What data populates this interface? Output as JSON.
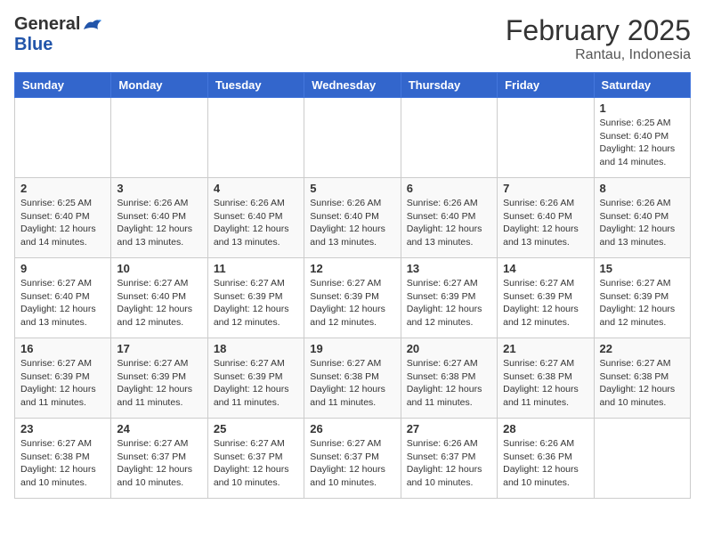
{
  "header": {
    "logo_general": "General",
    "logo_blue": "Blue",
    "title": "February 2025",
    "subtitle": "Rantau, Indonesia"
  },
  "days_of_week": [
    "Sunday",
    "Monday",
    "Tuesday",
    "Wednesday",
    "Thursday",
    "Friday",
    "Saturday"
  ],
  "weeks": [
    [
      {
        "day": "",
        "info": ""
      },
      {
        "day": "",
        "info": ""
      },
      {
        "day": "",
        "info": ""
      },
      {
        "day": "",
        "info": ""
      },
      {
        "day": "",
        "info": ""
      },
      {
        "day": "",
        "info": ""
      },
      {
        "day": "1",
        "info": "Sunrise: 6:25 AM\nSunset: 6:40 PM\nDaylight: 12 hours\nand 14 minutes."
      }
    ],
    [
      {
        "day": "2",
        "info": "Sunrise: 6:25 AM\nSunset: 6:40 PM\nDaylight: 12 hours\nand 14 minutes."
      },
      {
        "day": "3",
        "info": "Sunrise: 6:26 AM\nSunset: 6:40 PM\nDaylight: 12 hours\nand 13 minutes."
      },
      {
        "day": "4",
        "info": "Sunrise: 6:26 AM\nSunset: 6:40 PM\nDaylight: 12 hours\nand 13 minutes."
      },
      {
        "day": "5",
        "info": "Sunrise: 6:26 AM\nSunset: 6:40 PM\nDaylight: 12 hours\nand 13 minutes."
      },
      {
        "day": "6",
        "info": "Sunrise: 6:26 AM\nSunset: 6:40 PM\nDaylight: 12 hours\nand 13 minutes."
      },
      {
        "day": "7",
        "info": "Sunrise: 6:26 AM\nSunset: 6:40 PM\nDaylight: 12 hours\nand 13 minutes."
      },
      {
        "day": "8",
        "info": "Sunrise: 6:26 AM\nSunset: 6:40 PM\nDaylight: 12 hours\nand 13 minutes."
      }
    ],
    [
      {
        "day": "9",
        "info": "Sunrise: 6:27 AM\nSunset: 6:40 PM\nDaylight: 12 hours\nand 13 minutes."
      },
      {
        "day": "10",
        "info": "Sunrise: 6:27 AM\nSunset: 6:40 PM\nDaylight: 12 hours\nand 12 minutes."
      },
      {
        "day": "11",
        "info": "Sunrise: 6:27 AM\nSunset: 6:39 PM\nDaylight: 12 hours\nand 12 minutes."
      },
      {
        "day": "12",
        "info": "Sunrise: 6:27 AM\nSunset: 6:39 PM\nDaylight: 12 hours\nand 12 minutes."
      },
      {
        "day": "13",
        "info": "Sunrise: 6:27 AM\nSunset: 6:39 PM\nDaylight: 12 hours\nand 12 minutes."
      },
      {
        "day": "14",
        "info": "Sunrise: 6:27 AM\nSunset: 6:39 PM\nDaylight: 12 hours\nand 12 minutes."
      },
      {
        "day": "15",
        "info": "Sunrise: 6:27 AM\nSunset: 6:39 PM\nDaylight: 12 hours\nand 12 minutes."
      }
    ],
    [
      {
        "day": "16",
        "info": "Sunrise: 6:27 AM\nSunset: 6:39 PM\nDaylight: 12 hours\nand 11 minutes."
      },
      {
        "day": "17",
        "info": "Sunrise: 6:27 AM\nSunset: 6:39 PM\nDaylight: 12 hours\nand 11 minutes."
      },
      {
        "day": "18",
        "info": "Sunrise: 6:27 AM\nSunset: 6:39 PM\nDaylight: 12 hours\nand 11 minutes."
      },
      {
        "day": "19",
        "info": "Sunrise: 6:27 AM\nSunset: 6:38 PM\nDaylight: 12 hours\nand 11 minutes."
      },
      {
        "day": "20",
        "info": "Sunrise: 6:27 AM\nSunset: 6:38 PM\nDaylight: 12 hours\nand 11 minutes."
      },
      {
        "day": "21",
        "info": "Sunrise: 6:27 AM\nSunset: 6:38 PM\nDaylight: 12 hours\nand 11 minutes."
      },
      {
        "day": "22",
        "info": "Sunrise: 6:27 AM\nSunset: 6:38 PM\nDaylight: 12 hours\nand 10 minutes."
      }
    ],
    [
      {
        "day": "23",
        "info": "Sunrise: 6:27 AM\nSunset: 6:38 PM\nDaylight: 12 hours\nand 10 minutes."
      },
      {
        "day": "24",
        "info": "Sunrise: 6:27 AM\nSunset: 6:37 PM\nDaylight: 12 hours\nand 10 minutes."
      },
      {
        "day": "25",
        "info": "Sunrise: 6:27 AM\nSunset: 6:37 PM\nDaylight: 12 hours\nand 10 minutes."
      },
      {
        "day": "26",
        "info": "Sunrise: 6:27 AM\nSunset: 6:37 PM\nDaylight: 12 hours\nand 10 minutes."
      },
      {
        "day": "27",
        "info": "Sunrise: 6:26 AM\nSunset: 6:37 PM\nDaylight: 12 hours\nand 10 minutes."
      },
      {
        "day": "28",
        "info": "Sunrise: 6:26 AM\nSunset: 6:36 PM\nDaylight: 12 hours\nand 10 minutes."
      },
      {
        "day": "",
        "info": ""
      }
    ]
  ]
}
